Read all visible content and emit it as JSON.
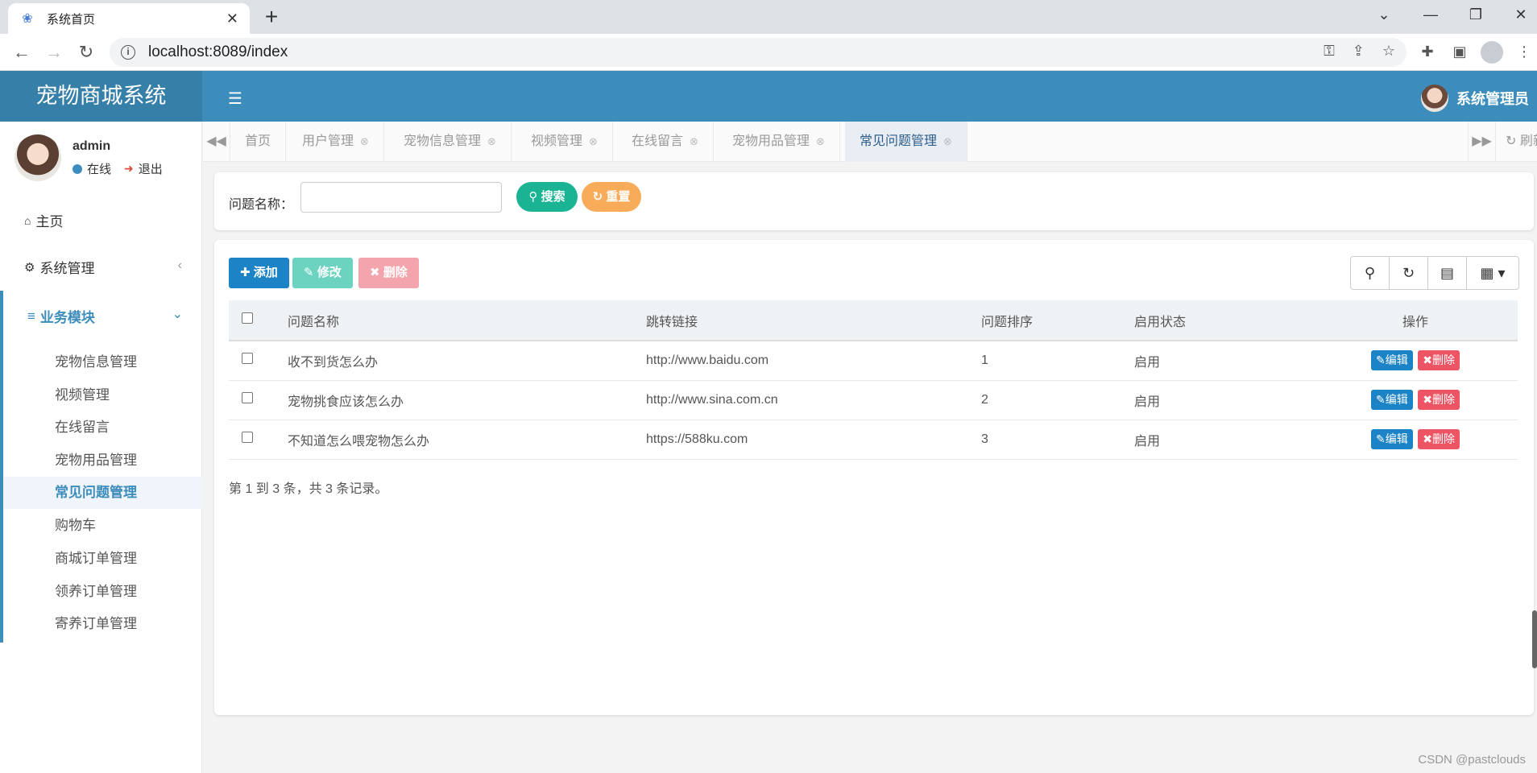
{
  "browser": {
    "tab_title": "系统首页",
    "url": "localhost:8089/index"
  },
  "header": {
    "logo": "宠物商城系统",
    "user_name": "系统管理员"
  },
  "sidebar": {
    "user": "admin",
    "status": "在线",
    "logout": "退出",
    "home": "主页",
    "system": "系统管理",
    "business": "业务模块",
    "items": [
      {
        "label": "宠物信息管理",
        "active": false
      },
      {
        "label": "视频管理",
        "active": false
      },
      {
        "label": "在线留言",
        "active": false
      },
      {
        "label": "宠物用品管理",
        "active": false
      },
      {
        "label": "常见问题管理",
        "active": true
      },
      {
        "label": "购物车",
        "active": false
      },
      {
        "label": "商城订单管理",
        "active": false
      },
      {
        "label": "领养订单管理",
        "active": false
      },
      {
        "label": "寄养订单管理",
        "active": false
      }
    ]
  },
  "tabs": {
    "items": [
      "首页",
      "用户管理",
      "宠物信息管理",
      "视频管理",
      "在线留言",
      "宠物用品管理",
      "常见问题管理"
    ],
    "active": "常见问题管理",
    "refresh": "刷新"
  },
  "search": {
    "label": "问题名称：",
    "value": "",
    "search_btn": "搜索",
    "reset_btn": "重置"
  },
  "toolbar": {
    "add": "添加",
    "edit": "修改",
    "delete": "删除"
  },
  "table": {
    "columns": [
      "问题名称",
      "跳转链接",
      "问题排序",
      "启用状态",
      "操作"
    ],
    "rows": [
      {
        "name": "收不到货怎么办",
        "link": "http://www.baidu.com",
        "sort": "1",
        "status": "启用"
      },
      {
        "name": "宠物挑食应该怎么办",
        "link": "http://www.sina.com.cn",
        "sort": "2",
        "status": "启用"
      },
      {
        "name": "不知道怎么喂宠物怎么办",
        "link": "https://588ku.com",
        "sort": "3",
        "status": "启用"
      }
    ],
    "edit_label": "编辑",
    "delete_label": "删除",
    "pager": "第 1 到 3 条，共 3 条记录。"
  },
  "watermark": "CSDN @pastclouds",
  "colors": {
    "primary": "#3c8dbc",
    "header_logo": "#367fa9",
    "search": "#1ab394",
    "reset": "#f8ac59",
    "edit": "#1c84c6",
    "danger": "#ed5565"
  }
}
